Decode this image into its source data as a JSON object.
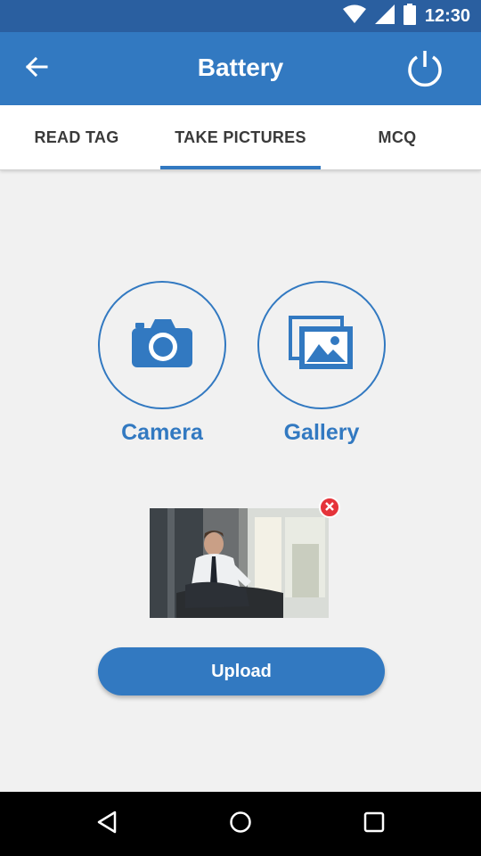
{
  "status_bar": {
    "time": "12:30",
    "icons": [
      "wifi-icon",
      "signal-icon",
      "battery-icon"
    ]
  },
  "app_bar": {
    "title": "Battery",
    "back_icon": "arrow-left-icon",
    "power_icon": "power-icon"
  },
  "tabs": [
    {
      "label": "READ TAG",
      "active": false
    },
    {
      "label": "TAKE PICTURES",
      "active": true
    },
    {
      "label": "MCQ",
      "active": false
    }
  ],
  "options": {
    "camera": {
      "label": "Camera",
      "icon": "camera-icon"
    },
    "gallery": {
      "label": "Gallery",
      "icon": "gallery-icon"
    }
  },
  "attachment": {
    "remove_icon": "close-icon"
  },
  "upload": {
    "label": "Upload"
  },
  "nav_bar": {
    "icons": [
      "back-triangle-icon",
      "home-circle-icon",
      "recents-square-icon"
    ]
  },
  "colors": {
    "status_bar": "#2a5fa0",
    "primary": "#3279c1",
    "background": "#f1f1f1",
    "remove": "#e5333a"
  }
}
